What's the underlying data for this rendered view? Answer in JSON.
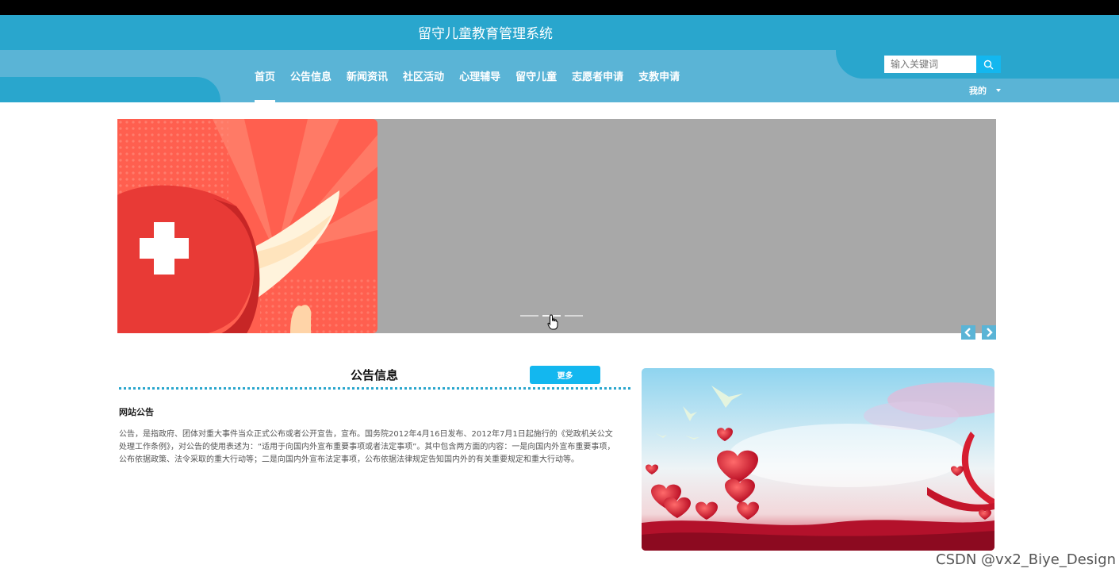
{
  "header": {
    "title": "留守儿童教育管理系统",
    "nav": [
      "首页",
      "公告信息",
      "新闻资讯",
      "社区活动",
      "心理辅导",
      "留守儿童",
      "志愿者申请",
      "支教申请"
    ],
    "active_nav": "首页",
    "search_placeholder": "输入关键词",
    "mine_label": "我的"
  },
  "banner": {
    "dot_count": 3,
    "active_dot": 2
  },
  "notice": {
    "section_title": "公告信息",
    "more_label": "更多",
    "item_title": "网站公告",
    "item_body": "公告，是指政府、团体对重大事件当众正式公布或者公开宣告，宣布。国务院2012年4月16日发布、2012年7月1日起施行的《党政机关公文处理工作条例》，对公告的使用表述为：“适用于向国内外宣布重要事项或者法定事项”。其中包含两方面的内容：一是向国内外宣布重要事项，公布依据政策、法令采取的重大行动等；二是向国内外宣布法定事项，公布依据法律规定告知国内外的有关重要规定和重大行动等。"
  },
  "watermark": "CSDN @vx2_Biye_Design",
  "colors": {
    "header_dark": "#29a6cd",
    "header_light": "#5ab4d6",
    "accent": "#13b7ef",
    "banner_gray": "#a8a8a8"
  }
}
